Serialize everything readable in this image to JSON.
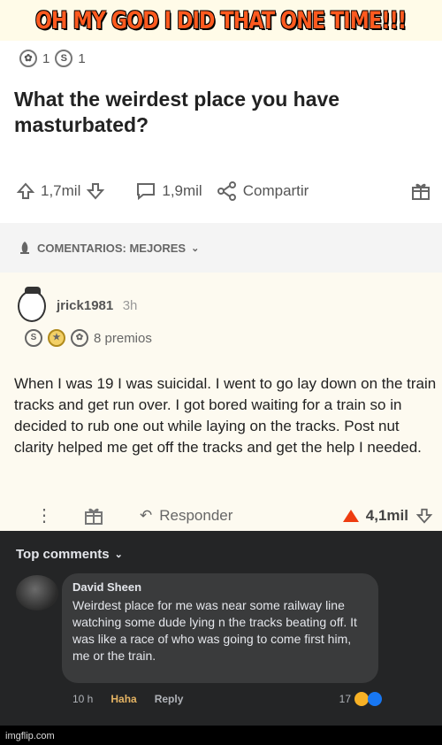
{
  "meme": {
    "caption": "OH MY GOD I DID THAT ONE TIME!!!"
  },
  "post": {
    "award_count_1": "1",
    "award_count_2": "1",
    "title": "What the weirdest place you have masturbated?",
    "upvotes": "1,7mil",
    "comments": "1,9mil",
    "share_label": "Compartir"
  },
  "sort_bar": {
    "label": "COMENTARIOS: MEJORES"
  },
  "comment": {
    "username": "jrick1981",
    "time": "3h",
    "awards_label": "8 premios",
    "body": "When I was 19 I was suicidal. I went to go lay down on the train tracks and get run over. I got bored waiting for a train so in decided to rub one out while laying on the tracks. Post nut clarity helped me get off the tracks and get the help I needed.",
    "reply_label": "Responder",
    "votes": "4,1mil"
  },
  "facebook": {
    "section_title": "Top comments",
    "commenter": "David Sheen",
    "comment_text": "Weirdest place for me was near some railway line watching some dude lying n the tracks beating off. It was like a race of who was going to come first him, me or the train.",
    "time": "10 h",
    "reaction": "Haha",
    "reply": "Reply",
    "reaction_count": "17"
  },
  "watermark": "imgflip.com"
}
